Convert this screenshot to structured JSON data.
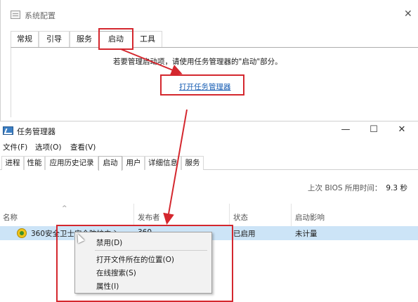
{
  "msconfig": {
    "title": "系统配置",
    "close_glyph": "✕",
    "tabs": [
      {
        "label": "常规"
      },
      {
        "label": "引导"
      },
      {
        "label": "服务"
      },
      {
        "label": "启动",
        "active": true
      },
      {
        "label": "工具"
      }
    ],
    "hint": "若要管理启动项，请使用任务管理器的\"启动\"部分。",
    "link": "打开任务管理器"
  },
  "taskmgr": {
    "title": "任务管理器",
    "window_buttons": {
      "minimize": "—",
      "maximize": "☐",
      "close": "✕"
    },
    "menu": [
      "文件(F)",
      "选项(O)",
      "查看(V)"
    ],
    "tabs": [
      {
        "label": "进程"
      },
      {
        "label": "性能"
      },
      {
        "label": "应用历史记录"
      },
      {
        "label": "启动",
        "active": true
      },
      {
        "label": "用户"
      },
      {
        "label": "详细信息"
      },
      {
        "label": "服务"
      }
    ],
    "bios_label": "上次 BIOS 所用时间：",
    "bios_value": "9.3 秒",
    "sort_glyph": "^",
    "columns": [
      "名称",
      "发布者",
      "状态",
      "启动影响"
    ],
    "rows": [
      {
        "name": "360安全卫士安全防护中心",
        "publisher": "360",
        "status": "已启用",
        "impact": "未计量"
      }
    ],
    "context_menu": [
      "禁用(D)",
      "打开文件所在的位置(O)",
      "在线搜索(S)",
      "属性(I)"
    ]
  },
  "colors": {
    "annotation": "#d4272e",
    "link": "#1a5fb4",
    "row_selected": "#cce4f7"
  }
}
